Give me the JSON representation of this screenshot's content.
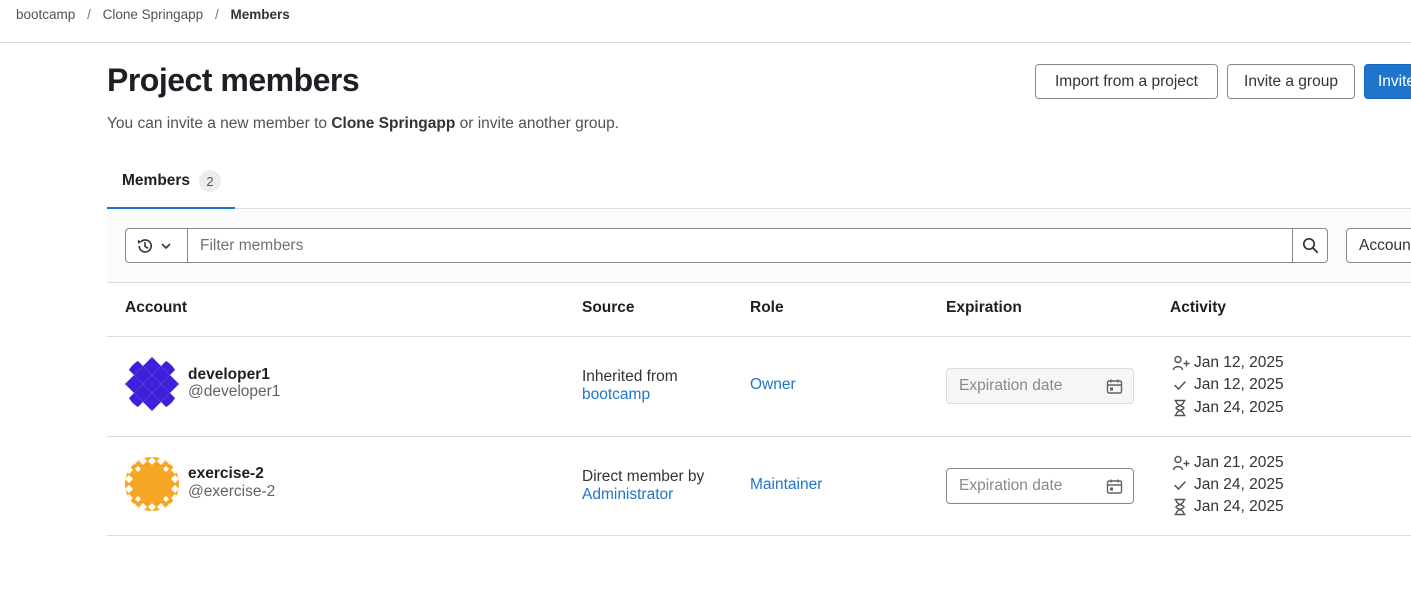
{
  "breadcrumb": [
    {
      "label": "bootcamp"
    },
    {
      "label": "Clone Springapp"
    },
    {
      "label": "Members"
    }
  ],
  "breadcrumb_separator": "/",
  "page": {
    "title": "Project members",
    "subtitle_prefix": "You can invite a new member to ",
    "subtitle_project": "Clone Springapp",
    "subtitle_suffix": " or invite another group."
  },
  "actions": {
    "import_label": "Import from a project",
    "invite_group_label": "Invite a group",
    "invite_members_label": "Invite"
  },
  "tabs": [
    {
      "label": "Members",
      "count": "2",
      "active": true
    }
  ],
  "filter": {
    "placeholder": "Filter members",
    "sort_label": "Account"
  },
  "table": {
    "columns": [
      "Account",
      "Source",
      "Role",
      "Expiration",
      "Activity"
    ],
    "rows": [
      {
        "name": "developer1",
        "username": "@developer1",
        "source_text": "Inherited from",
        "source_link": "bootcamp",
        "role": "Owner",
        "expiration_placeholder": "Expiration date",
        "user_created": "Jan 12, 2025",
        "access_granted": "Jan 12, 2025",
        "last_activity": "Jan 24, 2025"
      },
      {
        "name": "exercise-2",
        "username": "@exercise-2",
        "source_text": "Direct member by",
        "source_link": "Administrator",
        "role": "Maintainer",
        "expiration_placeholder": "Expiration date",
        "user_created": "Jan 21, 2025",
        "access_granted": "Jan 24, 2025",
        "last_activity": "Jan 24, 2025"
      }
    ]
  },
  "colors": {
    "accent": "#1f75cb",
    "avatar_1": "#3d22d9",
    "avatar_2": "#f5a623"
  },
  "icons": [
    "history-icon",
    "chevron-down-icon",
    "search-icon",
    "calendar-icon",
    "user-added-icon",
    "check-icon",
    "hourglass-icon"
  ]
}
